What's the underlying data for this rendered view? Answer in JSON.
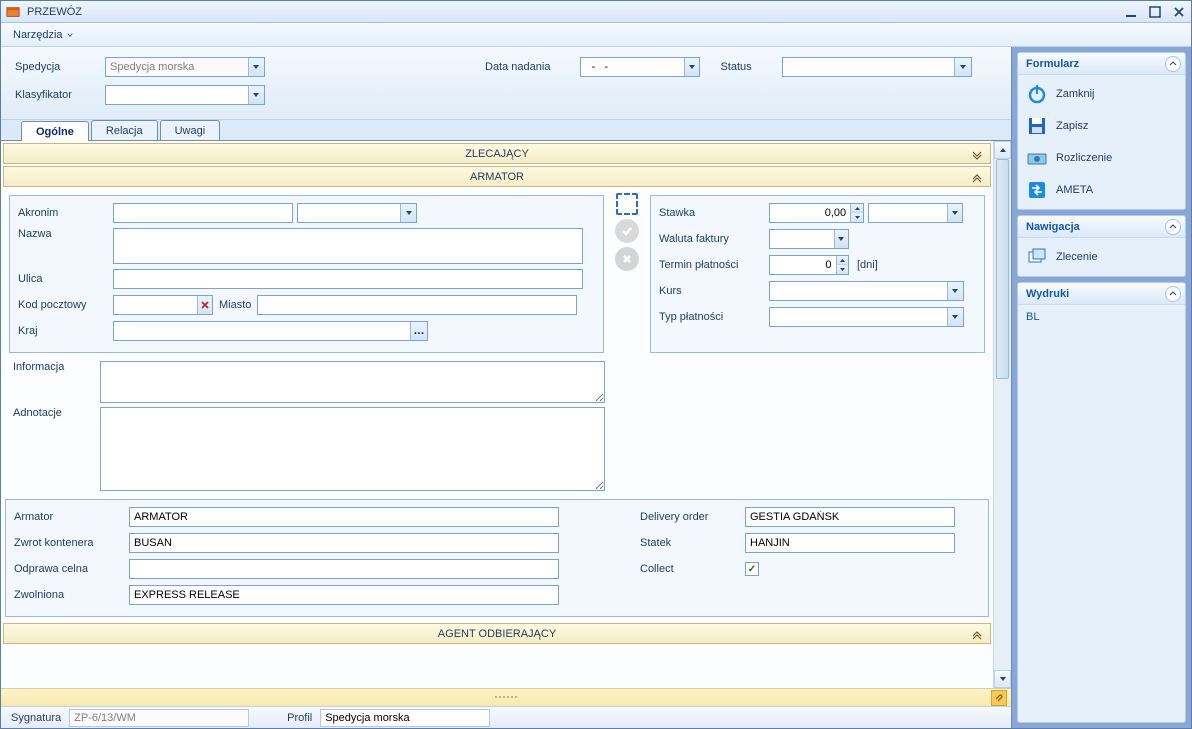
{
  "window": {
    "title": "PRZEWÓZ"
  },
  "menu": {
    "tools": "Narzędzia"
  },
  "header": {
    "spedycja_label": "Spedycja",
    "spedycja_value": "Spedycja morska",
    "klasyfikator_label": "Klasyfikator",
    "data_nadania_label": "Data nadania",
    "data_nadania_value": "  -   -",
    "status_label": "Status"
  },
  "tabs": {
    "t0": "Ogólne",
    "t1": "Relacja",
    "t2": "Uwagi"
  },
  "sections": {
    "zlecajacy": "ZLECAJĄCY",
    "armator": "ARMATOR",
    "agent": "AGENT ODBIERAJĄCY"
  },
  "armator_addr": {
    "akronim": "Akronim",
    "nazwa": "Nazwa",
    "ulica": "Ulica",
    "kod": "Kod pocztowy",
    "miasto": "Miasto",
    "kraj": "Kraj",
    "informacja": "Informacja",
    "adnotacje": "Adnotacje"
  },
  "armator_fin": {
    "stawka": "Stawka",
    "stawka_val": "0,00",
    "waluta": "Waluta faktury",
    "termin": "Termin płatności",
    "termin_val": "0",
    "termin_unit": "[dni]",
    "kurs": "Kurs",
    "typ": "Typ płatności"
  },
  "bottom": {
    "armator_label": "Armator",
    "armator_val": "ARMATOR",
    "zwrot_label": "Zwrot kontenera",
    "zwrot_val": "BUSAN",
    "odprawa_label": "Odprawa celna",
    "odprawa_val": "",
    "zwolniona_label": "Zwolniona",
    "zwolniona_val": "EXPRESS RELEASE",
    "delivery_label": "Delivery order",
    "delivery_val": "GESTIA GDAŃSK",
    "statek_label": "Statek",
    "statek_val": "HANJIN",
    "collect_label": "Collect",
    "collect_checked": true
  },
  "footer": {
    "sygnatura_label": "Sygnatura",
    "sygnatura_val": "ZP-6/13/WM",
    "profil_label": "Profil",
    "profil_val": "Spedycja morska"
  },
  "side": {
    "formularz": {
      "title": "Formularz",
      "zamknij": "Zamknij",
      "zapisz": "Zapisz",
      "rozliczenie": "Rozliczenie",
      "ameta": "AMETA"
    },
    "nawigacja": {
      "title": "Nawigacja",
      "zlecenie": "Zlecenie"
    },
    "wydruki": {
      "title": "Wydruki",
      "bl": "BL"
    }
  }
}
